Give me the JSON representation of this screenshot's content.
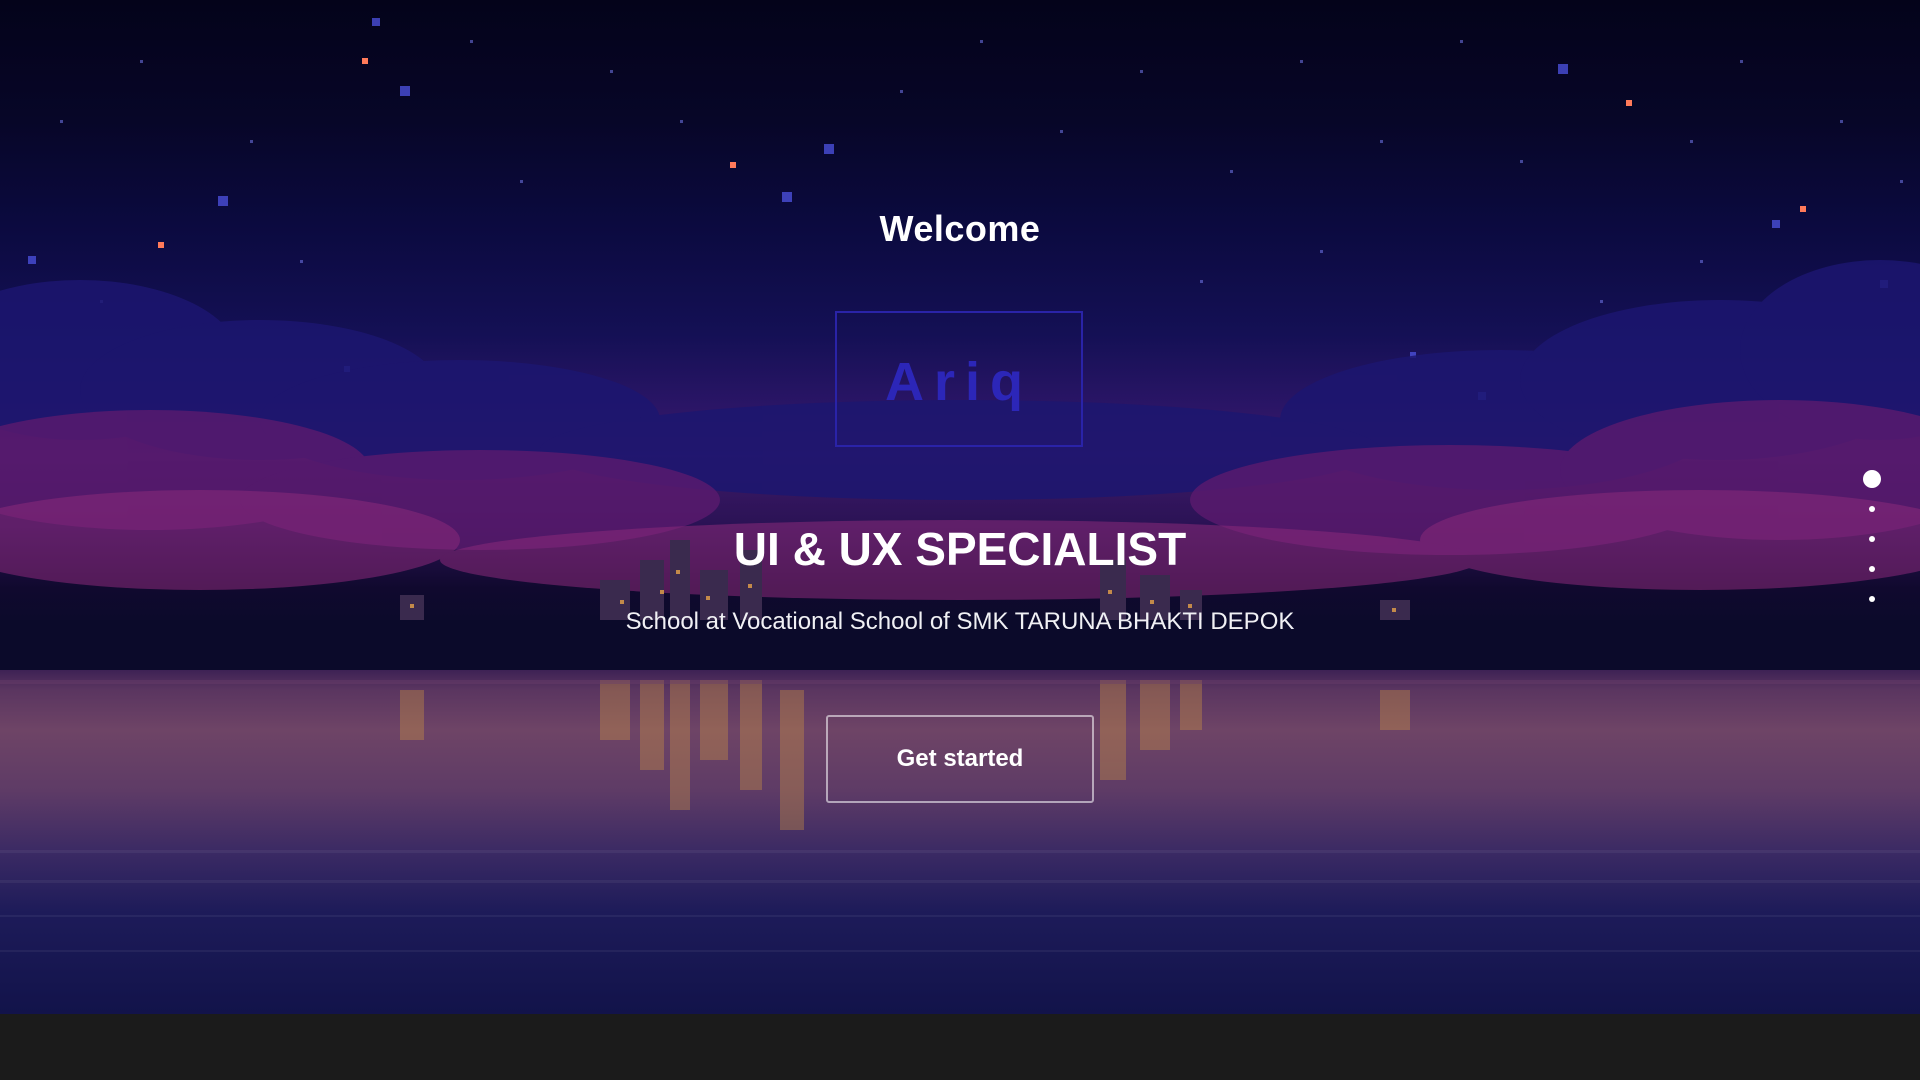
{
  "hero": {
    "welcome": "Welcome",
    "logo_text": "Ariq",
    "title": "UI & UX SPECIALIST",
    "subtitle": "School at Vocational School of SMK TARUNA BHAKTI DEPOK",
    "cta_label": "Get started"
  },
  "pagination": {
    "count": 5,
    "active_index": 0
  },
  "colors": {
    "logo_accent": "#2c26b8",
    "text": "#ffffff",
    "bottom_bar": "#1b1b1b"
  }
}
